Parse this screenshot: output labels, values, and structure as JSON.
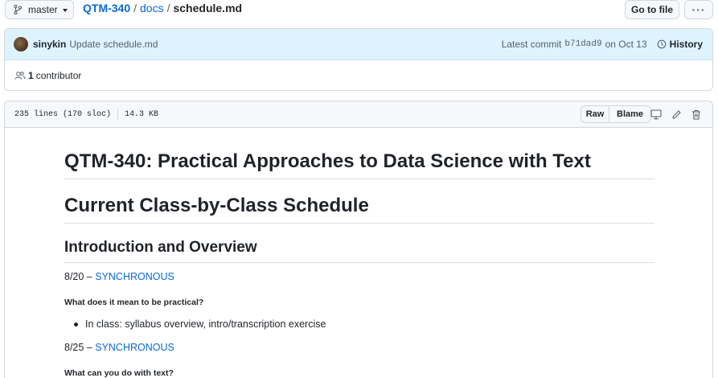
{
  "branch": {
    "name": "master"
  },
  "breadcrumb": {
    "repo": "QTM-340",
    "folder": "docs",
    "file": "schedule.md",
    "separator": "/"
  },
  "actions": {
    "goto_file": "Go to file",
    "more": "···"
  },
  "commit": {
    "author": "sinykin",
    "message": "Update schedule.md",
    "latest_label": "Latest commit",
    "sha": "b71dad9",
    "date": "on Oct 13",
    "history_label": "History"
  },
  "contributors": {
    "count": "1",
    "label": "contributor"
  },
  "file_info": {
    "lines": "235 lines (170 sloc)",
    "size": "14.3 KB"
  },
  "file_actions": {
    "raw": "Raw",
    "blame": "Blame"
  },
  "icons": [
    "branch-icon",
    "caret-down-icon",
    "history-icon",
    "people-icon",
    "desktop-icon",
    "pencil-icon",
    "trash-icon"
  ],
  "colors": {
    "link": "#0969da",
    "commit_bg": "#ddf4ff",
    "border": "#d0d7de"
  },
  "document": {
    "title": "QTM-340: Practical Approaches to Data Science with Text",
    "subtitle": "Current Class-by-Class Schedule",
    "section": "Introduction and Overview",
    "entries": [
      {
        "date": "8/20 –",
        "mode": "SYNCHRONOUS",
        "question": "What does it mean to be practical?",
        "bullet": "In class: syllabus overview, intro/transcription exercise"
      },
      {
        "date": "8/25 –",
        "mode": "SYNCHRONOUS",
        "question": "What can you do with text?"
      }
    ]
  }
}
